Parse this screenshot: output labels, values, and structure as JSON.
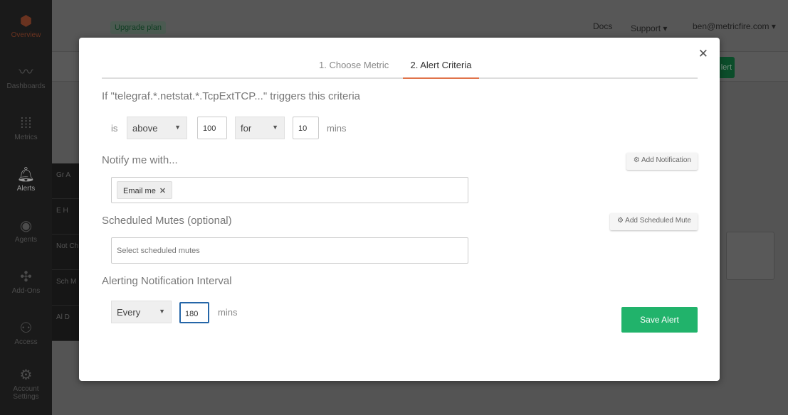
{
  "sidebar": {
    "items": [
      {
        "label": "Overview",
        "icon": "metricfire-logo"
      },
      {
        "label": "Dashboards",
        "icon": "chart-line-icon"
      },
      {
        "label": "Metrics",
        "icon": "sliders-icon"
      },
      {
        "label": "Alerts",
        "icon": "bell-icon"
      },
      {
        "label": "Agents",
        "icon": "eye-icon"
      },
      {
        "label": "Add-Ons",
        "icon": "puzzle-icon"
      },
      {
        "label": "Access",
        "icon": "users-icon"
      },
      {
        "label": "Account Settings",
        "icon": "gear-icon"
      }
    ],
    "submenu": [
      "Gr A",
      "E H",
      "Not Ch",
      "Sch M",
      "Al D"
    ]
  },
  "topbar": {
    "upgrade": "Upgrade plan",
    "docs": "Docs",
    "support": "Support ▾",
    "user": "ben@metricfire.com ▾",
    "bg_button": "lert"
  },
  "modal": {
    "tabs": [
      "1. Choose Metric",
      "2. Alert Criteria"
    ],
    "active_tab": 1,
    "criteria_title": "If \"telegraf.*.netstat.*.TcpExtTCP...\" triggers this criteria",
    "is_label": "is",
    "operator": "above",
    "threshold": "100",
    "duration_mode": "for",
    "duration": "10",
    "mins": "mins",
    "notify_title": "Notify me with...",
    "add_notification": "Add Notification",
    "notifications": [
      "Email me"
    ],
    "mutes_title": "Scheduled Mutes (optional)",
    "add_mute": "Add Scheduled Mute",
    "mutes_placeholder": "Select scheduled mutes",
    "interval_title": "Alerting Notification Interval",
    "interval_mode": "Every",
    "interval": "180",
    "interval_unit": "mins",
    "save": "Save Alert"
  },
  "colors": {
    "accent": "#e0734a",
    "save": "#21b36b",
    "focus": "#2566a8"
  }
}
